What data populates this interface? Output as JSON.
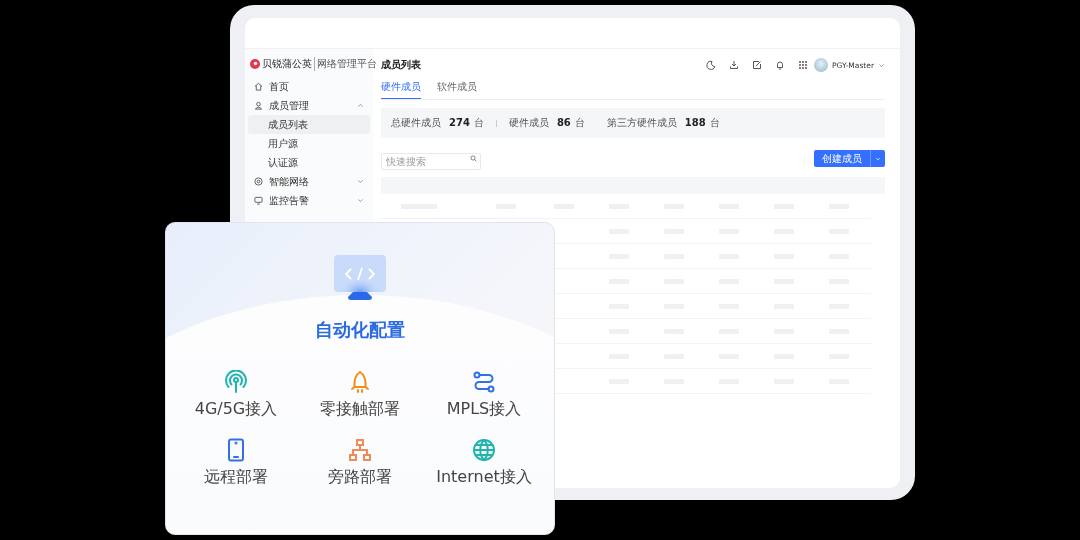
{
  "brand": {
    "name": "贝锐蒲公英",
    "subtitle": "网络管理平台"
  },
  "sidebar": {
    "items": [
      {
        "label": "首页",
        "kind": "home",
        "selected": false
      },
      {
        "label": "成员管理",
        "kind": "user",
        "expanded": true,
        "selected": false,
        "children": [
          {
            "label": "成员列表",
            "selected": true
          },
          {
            "label": "用户源",
            "selected": false
          },
          {
            "label": "认证源",
            "selected": false
          }
        ]
      },
      {
        "label": "智能网络",
        "kind": "network",
        "expanded": false,
        "selected": false
      },
      {
        "label": "监控告警",
        "kind": "monitor",
        "expanded": false,
        "selected": false
      }
    ]
  },
  "header": {
    "title": "成员列表",
    "user": "PGY-Master"
  },
  "tabs": [
    {
      "label": "硬件成员",
      "selected": true
    },
    {
      "label": "软件成员",
      "selected": false
    }
  ],
  "stats": [
    {
      "label": "总硬件成员",
      "value": "274",
      "unit": "台"
    },
    {
      "label": "硬件成员",
      "value": "86",
      "unit": "台"
    },
    {
      "label": "第三方硬件成员",
      "value": "188",
      "unit": "台"
    }
  ],
  "search": {
    "placeholder": "快速搜索"
  },
  "create_button": {
    "label": "创建成员"
  },
  "feature_card": {
    "title": "自动化配置",
    "features": [
      {
        "label": "4G/5G接入",
        "kind": "antenna"
      },
      {
        "label": "零接触部署",
        "kind": "rocket"
      },
      {
        "label": "MPLS接入",
        "kind": "route"
      },
      {
        "label": "远程部署",
        "kind": "phone"
      },
      {
        "label": "旁路部署",
        "kind": "tree"
      },
      {
        "label": "Internet接入",
        "kind": "globe"
      }
    ]
  }
}
